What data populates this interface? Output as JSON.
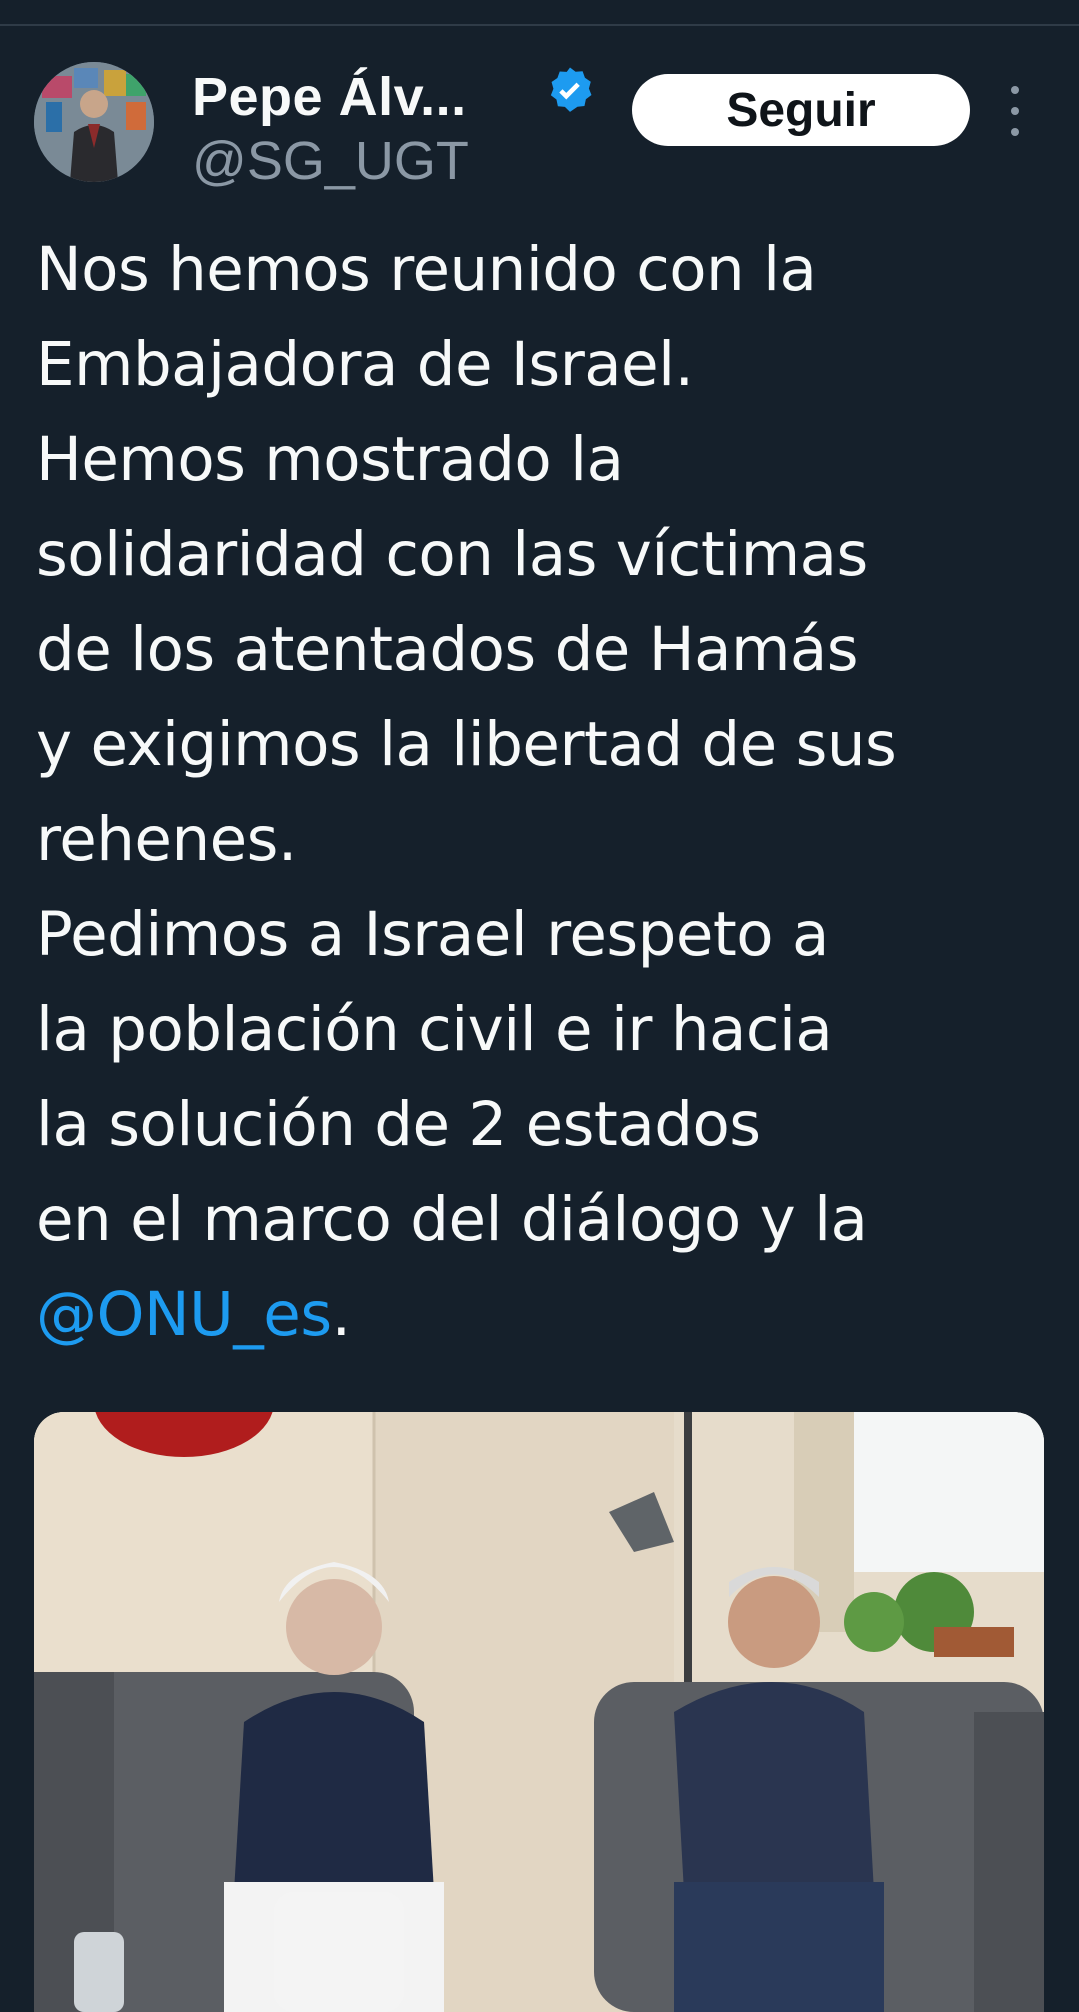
{
  "tweet": {
    "author": {
      "display_name": "Pepe Álv...",
      "handle": "@SG_UGT",
      "verified": true,
      "verified_color": "#1d9bf0"
    },
    "follow_button_label": "Seguir",
    "more_icon": "more-vertical-icon",
    "text_lines": [
      "Nos hemos reunido con la",
      "Embajadora de Israel.",
      "Hemos mostrado la",
      "solidaridad con las víctimas",
      "de los atentados de Hamás",
      "y exigimos la libertad de sus",
      "rehenes.",
      "Pedimos a Israel respeto a",
      "la población civil e ir hacia",
      "la solución de 2 estados",
      "en el marco del diálogo y la"
    ],
    "mention": "@ONU_es",
    "mention_suffix": ".",
    "mention_color": "#1d9bf0"
  },
  "colors": {
    "background": "#15202b",
    "text": "#f7f9f9",
    "secondary_text": "#8b98a5",
    "accent": "#1d9bf0"
  }
}
